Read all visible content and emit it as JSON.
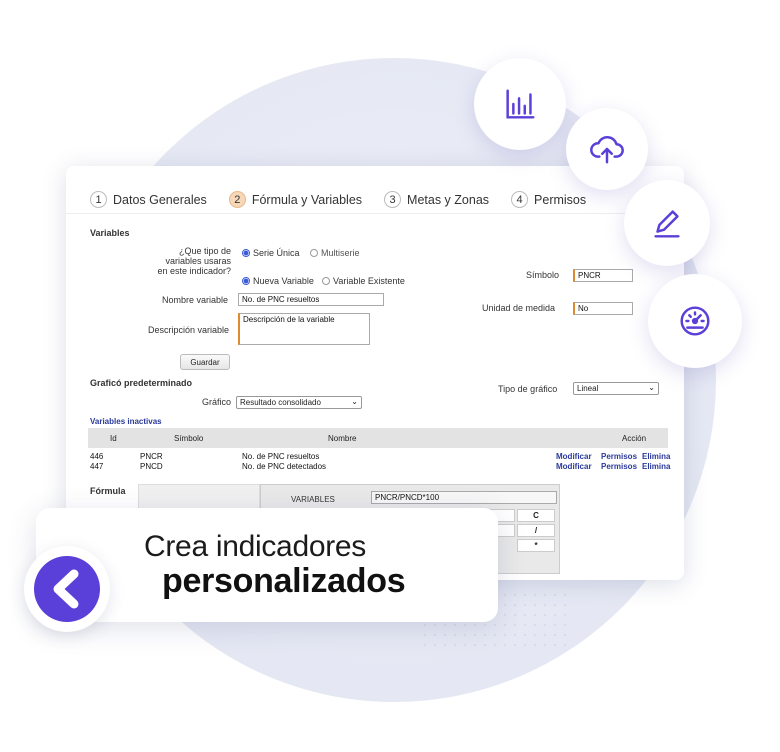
{
  "steps": [
    {
      "num": "1",
      "label": "Datos Generales"
    },
    {
      "num": "2",
      "label": "Fórmula y Variables"
    },
    {
      "num": "3",
      "label": "Metas y Zonas"
    },
    {
      "num": "4",
      "label": "Permisos"
    }
  ],
  "variables": {
    "section_title": "Variables",
    "question": "¿Que tipo de variables usaras en este indicador?",
    "radio_serie_unica": "Serie Única",
    "radio_multiserie": "Multiserie",
    "radio_nueva": "Nueva Variable",
    "radio_existente": "Variable Existente",
    "nombre_label": "Nombre variable",
    "nombre_value": "No. de PNC resueltos",
    "descripcion_label": "Descripción variable",
    "descripcion_value": "Descripción de la variable",
    "simbolo_label": "Símbolo",
    "simbolo_value": "PNCR",
    "unidad_label": "Unidad de medida",
    "unidad_value": "No",
    "guardar_label": "Guardar"
  },
  "grafico": {
    "section_title": "Graficó predeterminado",
    "grafico_label": "Gráfico",
    "grafico_value": "Resultado consolidado",
    "tipo_label": "Tipo de gráfico",
    "tipo_value": "Lineal"
  },
  "inactivas": {
    "title": "Variables inactivas",
    "headers": {
      "id": "Id",
      "simbolo": "Símbolo",
      "nombre": "Nombre",
      "accion": "Acción"
    },
    "rows": [
      {
        "id": "446",
        "simbolo": "PNCR",
        "nombre": "No. de PNC resueltos",
        "modificar": "Modificar",
        "permisos": "Permisos",
        "eliminar": "Elimina"
      },
      {
        "id": "447",
        "simbolo": "PNCD",
        "nombre": "No. de PNC detectados",
        "modificar": "Modificar",
        "permisos": "Permisos",
        "eliminar": "Elimina"
      }
    ]
  },
  "formula": {
    "label": "Fórmula",
    "variables_label": "VARIABLES",
    "formula_value": "PNCR/PNCD*100",
    "keys": [
      "C",
      "/",
      "*"
    ]
  },
  "banner": {
    "line1": "Crea indicadores",
    "line2": "personalizados"
  },
  "icons": [
    "bar-chart-icon",
    "cloud-upload-icon",
    "edit-icon",
    "dashboard-icon"
  ],
  "colors": {
    "accent": "#5b3fd9",
    "orange": "#e08a2e",
    "link": "#2a3a9a"
  }
}
